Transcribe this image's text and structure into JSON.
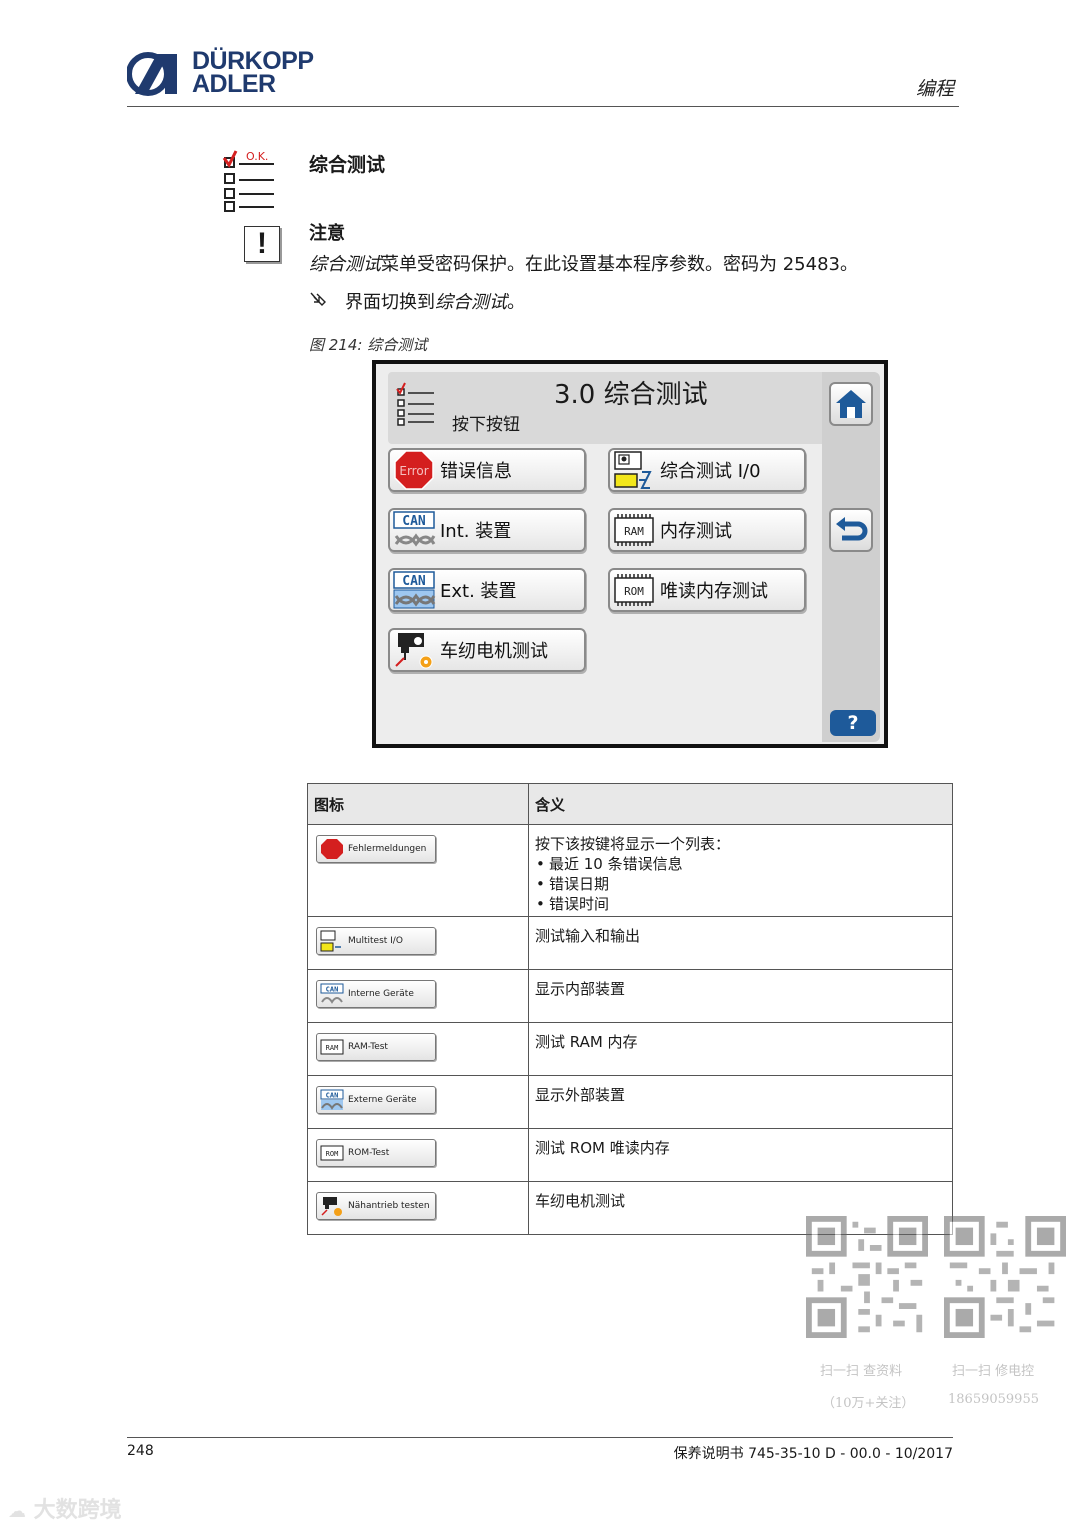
{
  "header": {
    "brand_line1": "DÜRKOPP",
    "brand_line2": "ADLER",
    "chapter": "编程"
  },
  "section": {
    "title": "综合测试",
    "note_title": "注意",
    "note_italic": "综合测试",
    "note_rest": "菜单受密码保护。在此设置基本程序参数。密码为 25483。",
    "step_prefix": "界面切换到",
    "step_italic": "综合测试",
    "step_suffix": "。",
    "figure_caption": "图 214: 综合测试"
  },
  "screen": {
    "title": "3.0 综合测试",
    "subtitle": "按下按钮",
    "menu_icon_text": "O.K.",
    "buttons": {
      "error_info": "错误信息",
      "multitest_io": "综合测试 I/0",
      "int_devices": "Int. 装置",
      "ram_test": "内存测试",
      "ext_devices": "Ext. 装置",
      "rom_test": "唯读内存测试",
      "motor_test": "车纫电机测试"
    },
    "icon_texts": {
      "error": "Error",
      "can": "CAN",
      "ram": "RAM",
      "rom": "ROM"
    },
    "help": "?"
  },
  "table": {
    "col_icon": "图标",
    "col_meaning": "含义",
    "rows": [
      {
        "button": "Fehlermeldungen",
        "meaning": "按下该按键将显示一个列表：",
        "bullets": [
          "最近 10 条错误信息",
          "错误日期",
          "错误时间"
        ]
      },
      {
        "button": "Multitest I/O",
        "meaning": "测试输入和输出"
      },
      {
        "button": "Interne Geräte",
        "meaning": "显示内部装置"
      },
      {
        "button": "RAM-Test",
        "meaning": "测试 RAM 内存"
      },
      {
        "button": "Externe Geräte",
        "meaning": "显示外部装置"
      },
      {
        "button": "ROM-Test",
        "meaning": "测试 ROM 唯读内存"
      },
      {
        "button": "Nähantrieb testen",
        "meaning": "车纫电机测试"
      }
    ]
  },
  "footer": {
    "page": "248",
    "doc": "保养说明书 745-35-10 D - 00.0 - 10/2017"
  },
  "watermark": {
    "qr1_line1": "扫一扫 查资料",
    "qr1_line2": "（10万+关注）",
    "qr2_line1": "扫一扫 修电控",
    "qr2_line2": "18659059955",
    "brand": "大数跨境"
  },
  "colors": {
    "brand_blue": "#1f3a6e",
    "screen_icon_blue": "#1e5a9a",
    "error_red": "#d41f1f"
  }
}
